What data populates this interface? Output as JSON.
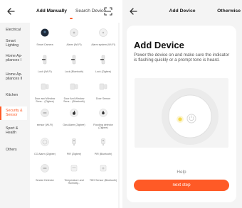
{
  "add_manually": {
    "tabs": [
      {
        "label": "Add Manually"
      },
      {
        "label": "Search Device"
      }
    ],
    "categories": [
      {
        "label": "Electrical"
      },
      {
        "label": "Smart Lighting"
      },
      {
        "label": "Home Ap- pliances I"
      },
      {
        "label": "Home Ap- pliances II"
      },
      {
        "label": "Kitchen"
      },
      {
        "label": "Security & Sensor"
      },
      {
        "label": "Sport & Health"
      },
      {
        "label": "Others"
      }
    ],
    "devices": [
      {
        "label": "Smart Camera",
        "icon": "camera-icon"
      },
      {
        "label": "Alarm (Wi-Fi)",
        "icon": "alarm-icon"
      },
      {
        "label": "Alarm system (Wi-Fi)",
        "icon": "alarm-system-icon"
      },
      {
        "label": "Lock (Wi-Fi)",
        "icon": "lock-icon"
      },
      {
        "label": "Lock (Bluetooth)",
        "icon": "lock-icon"
      },
      {
        "label": "Lock (Zigbee)",
        "icon": "lock-icon"
      },
      {
        "label": "Door and Window Sens... (Zigbee)",
        "icon": "door-sensor-icon"
      },
      {
        "label": "Door And Window Sens... (Bluetooth)",
        "icon": "door-sensor-icon"
      },
      {
        "label": "Door Sensor",
        "icon": "door-sensor-icon"
      },
      {
        "label": "sensor (Wi-Fi)",
        "icon": "sensor-icon"
      },
      {
        "label": "Gas Alarm (Zigbee)",
        "icon": "gas-alarm-icon"
      },
      {
        "label": "Flooding detector (Zigbee)",
        "icon": "flood-detector-icon"
      },
      {
        "label": "CO Alarm (Zigbee)",
        "icon": "co-alarm-icon"
      },
      {
        "label": "PIR (Zigbee)",
        "icon": "pir-icon"
      },
      {
        "label": "PIR (Bluetooth)",
        "icon": "pir-icon"
      },
      {
        "label": "Smoke Detector",
        "icon": "smoke-detector-icon"
      },
      {
        "label": "Temperature and Humidity...",
        "icon": "thermometer-icon"
      },
      {
        "label": "TBH Sensor (Bluetooth)",
        "icon": "sensor-icon"
      }
    ]
  },
  "add_device": {
    "header_title": "Add Device",
    "otherwise_label": "Otherwise",
    "card_title": "Add Device",
    "description": "Power the device on and make sure the indicator is flashing quickly or a prompt tone is heard.",
    "help_label": "Help",
    "next_label": "next step"
  },
  "colors": {
    "accent": "#ff5a26",
    "background": "#f4f4f4",
    "indicator": "#f5d94a"
  }
}
